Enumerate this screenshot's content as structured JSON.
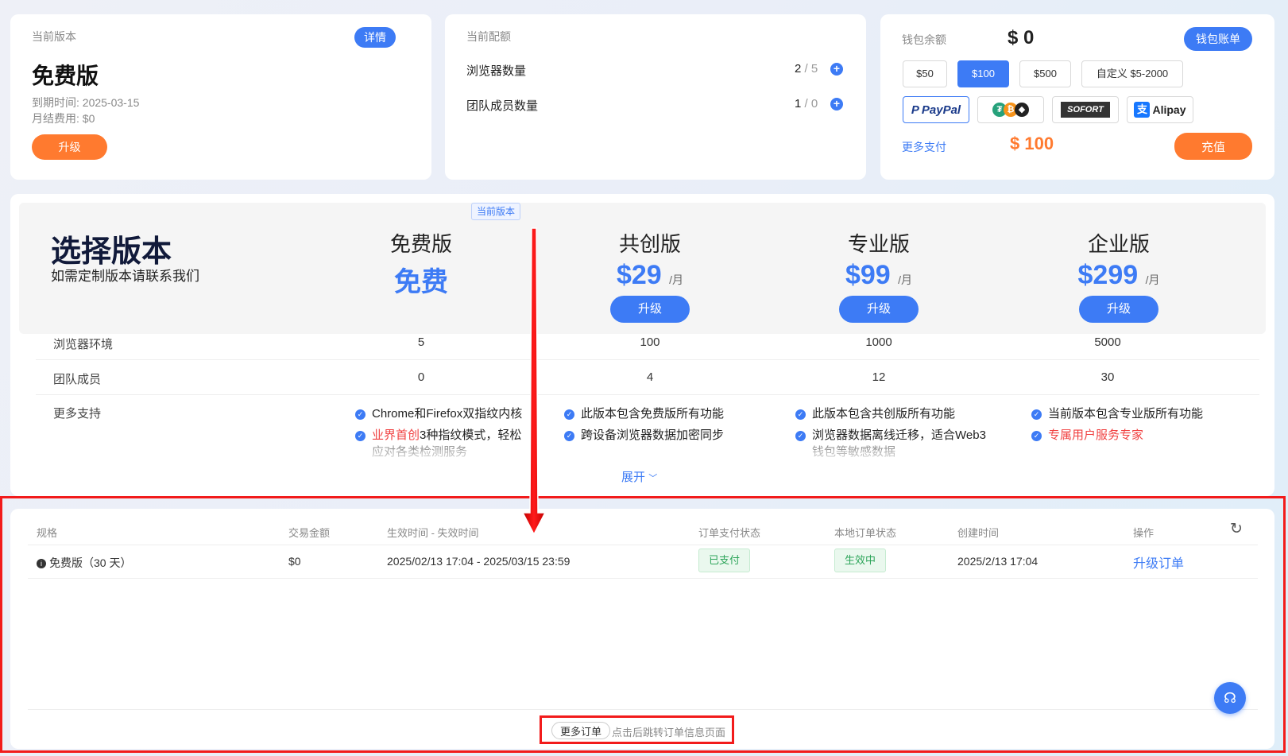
{
  "version_card": {
    "label": "当前版本",
    "detail_button": "详情",
    "plan_name": "免费版",
    "expire": "到期时间: 2025-03-15",
    "monthly_fee": "月结费用: $0",
    "upgrade_button": "升级"
  },
  "quota_card": {
    "label": "当前配额",
    "rows": [
      {
        "name": "浏览器数量",
        "used": "2",
        "total": "/ 5"
      },
      {
        "name": "团队成员数量",
        "used": "1",
        "total": "/ 0"
      }
    ]
  },
  "wallet_card": {
    "label": "钱包余额",
    "balance": "$ 0",
    "bill_button": "钱包账单",
    "amounts": [
      "$50",
      "$100",
      "$500",
      "自定义 $5-2000"
    ],
    "selected_amount": "$100",
    "payments": [
      "PayPal",
      "USDT",
      "SOFORT",
      "Alipay"
    ],
    "more_payment": "更多支付",
    "total": "$ 100",
    "recharge_button": "充值"
  },
  "plans": {
    "title": "选择版本",
    "subtitle": "如需定制版本请联系我们",
    "current_tag": "当前版本",
    "columns": [
      {
        "name": "免费版",
        "price": "免费",
        "unit": "",
        "button": ""
      },
      {
        "name": "共创版",
        "price": "$29",
        "unit": "/月",
        "button": "升级"
      },
      {
        "name": "专业版",
        "price": "$99",
        "unit": "/月",
        "button": "升级"
      },
      {
        "name": "企业版",
        "price": "$299",
        "unit": "/月",
        "button": "升级"
      }
    ],
    "rows": [
      {
        "label": "浏览器环境",
        "values": [
          "5",
          "100",
          "1000",
          "5000"
        ]
      },
      {
        "label": "团队成员",
        "values": [
          "0",
          "4",
          "12",
          "30"
        ]
      }
    ],
    "support_label": "更多支持",
    "features": [
      [
        "Chrome和Firefox双指纹内核",
        "业界首创",
        "3种指纹模式，轻松",
        "应对各类检测服务"
      ],
      [
        "此版本包含免费版所有功能",
        "跨设备浏览器数据加密同步"
      ],
      [
        "此版本包含共创版所有功能",
        "浏览器数据离线迁移，适合Web3",
        "钱包等敏感数据"
      ],
      [
        "当前版本包含专业版所有功能",
        "专属用户服务专家"
      ]
    ],
    "expand": "展开"
  },
  "orders": {
    "headers": [
      "规格",
      "交易金额",
      "生效时间 - 失效时间",
      "订单支付状态",
      "本地订单状态",
      "创建时间",
      "操作"
    ],
    "row": {
      "spec": "免费版（30 天）",
      "amount": "$0",
      "period": "2025/02/13 17:04 - 2025/03/15 23:59",
      "pay_status": "已支付",
      "local_status": "生效中",
      "created": "2025/2/13 17:04",
      "action": "升级订单"
    },
    "more_button": "更多订单",
    "more_hint": "点击后跳转订单信息页面"
  },
  "colors": {
    "accent": "#3d7bf5",
    "orange": "#ff7a2f",
    "annotation_red": "#f21b1b"
  }
}
